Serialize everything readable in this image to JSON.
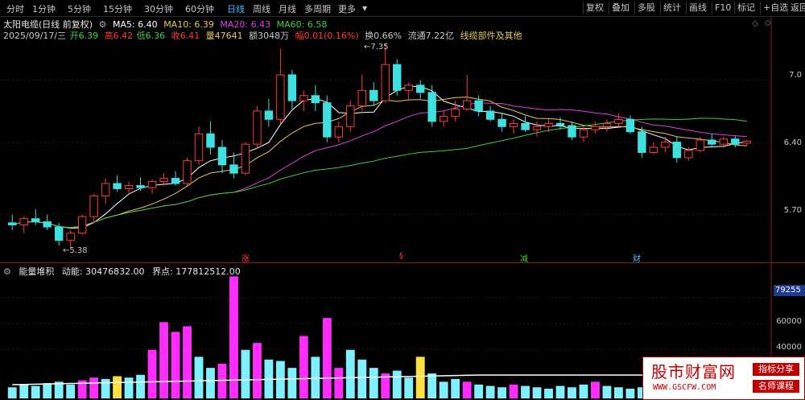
{
  "toolbar": {
    "tabs": [
      "分时",
      "1分钟",
      "5分钟",
      "15分钟",
      "30分钟",
      "60分钟",
      "日线",
      "周线",
      "月线",
      "多周期",
      "更多"
    ],
    "active_tab": "日线",
    "right_buttons": [
      "复权",
      "叠加",
      "多股",
      "统计",
      "画线",
      "F10",
      "标记",
      "+自选",
      "返回"
    ]
  },
  "header": {
    "stock_name": "太阳电缆(日线 前复权)",
    "ma5": "MA5: 6.40",
    "ma10": "MA10: 6.39",
    "ma20": "MA20: 6.43",
    "ma60": "MA60: 6.58",
    "date": "2025/09/17/三",
    "open": "开6.39",
    "high": "高6.42",
    "low": "低6.36",
    "close": "收6.41",
    "volume": "量47641",
    "amount": "额3048万",
    "change": "幅0.01(0.16%)",
    "turnover": "换0.66%",
    "float_cap": "流通7.22亿",
    "sector": "线缆部件及其他"
  },
  "price_axis": {
    "labels": [
      "7.0",
      "6.40",
      "5.70"
    ]
  },
  "annotations": {
    "high_label": "7.35",
    "low_label": "5.38"
  },
  "events": [
    "涨",
    "§",
    "减",
    "财"
  ],
  "volume_panel": {
    "indicator": "能量堆积",
    "momentum": "动能: 30476832.00",
    "boundary": "界点: 177812512.00",
    "axis_labels": [
      "79255",
      "60000",
      "40000"
    ],
    "current_tag": "79255"
  },
  "watermark": {
    "site_name": "股市财富网",
    "url": "WWW.GSCFW.COM",
    "tag1": "指标分享",
    "tag2": "名师课程"
  },
  "colors": {
    "up": "#ff3b3b",
    "down": "#3fe0e0",
    "ma5": "#ffffff",
    "ma10": "#e6c85a",
    "ma20": "#e040e0",
    "ma60": "#40d040",
    "vol_magenta": "#ff2cff",
    "vol_cyan": "#7ef0ff",
    "vol_yellow": "#ffe040"
  },
  "chart_data": {
    "type": "candlestick",
    "price_range": [
      5.3,
      7.4
    ],
    "candles": [
      {
        "o": 5.62,
        "h": 5.7,
        "l": 5.55,
        "c": 5.6
      },
      {
        "o": 5.6,
        "h": 5.68,
        "l": 5.52,
        "c": 5.66
      },
      {
        "o": 5.66,
        "h": 5.75,
        "l": 5.6,
        "c": 5.63
      },
      {
        "o": 5.63,
        "h": 5.7,
        "l": 5.55,
        "c": 5.58
      },
      {
        "o": 5.58,
        "h": 5.62,
        "l": 5.4,
        "c": 5.45
      },
      {
        "o": 5.45,
        "h": 5.55,
        "l": 5.38,
        "c": 5.52
      },
      {
        "o": 5.52,
        "h": 5.7,
        "l": 5.5,
        "c": 5.68
      },
      {
        "o": 5.68,
        "h": 5.9,
        "l": 5.62,
        "c": 5.88
      },
      {
        "o": 5.88,
        "h": 6.05,
        "l": 5.8,
        "c": 6.0
      },
      {
        "o": 6.0,
        "h": 6.08,
        "l": 5.92,
        "c": 5.95
      },
      {
        "o": 5.95,
        "h": 6.02,
        "l": 5.9,
        "c": 5.98
      },
      {
        "o": 5.98,
        "h": 6.06,
        "l": 5.93,
        "c": 5.96
      },
      {
        "o": 5.96,
        "h": 6.04,
        "l": 5.9,
        "c": 6.02
      },
      {
        "o": 6.02,
        "h": 6.1,
        "l": 5.98,
        "c": 6.05
      },
      {
        "o": 6.05,
        "h": 6.12,
        "l": 5.98,
        "c": 6.0
      },
      {
        "o": 6.0,
        "h": 6.25,
        "l": 5.98,
        "c": 6.22
      },
      {
        "o": 6.22,
        "h": 6.55,
        "l": 6.18,
        "c": 6.48
      },
      {
        "o": 6.48,
        "h": 6.6,
        "l": 6.28,
        "c": 6.35
      },
      {
        "o": 6.35,
        "h": 6.42,
        "l": 6.1,
        "c": 6.18
      },
      {
        "o": 6.18,
        "h": 6.3,
        "l": 6.05,
        "c": 6.1
      },
      {
        "o": 6.1,
        "h": 6.4,
        "l": 6.08,
        "c": 6.38
      },
      {
        "o": 6.38,
        "h": 6.75,
        "l": 6.35,
        "c": 6.7
      },
      {
        "o": 6.7,
        "h": 6.82,
        "l": 6.55,
        "c": 6.62
      },
      {
        "o": 6.62,
        "h": 7.3,
        "l": 6.58,
        "c": 7.05
      },
      {
        "o": 7.05,
        "h": 7.1,
        "l": 6.72,
        "c": 6.8
      },
      {
        "o": 6.8,
        "h": 6.9,
        "l": 6.7,
        "c": 6.85
      },
      {
        "o": 6.85,
        "h": 6.95,
        "l": 6.7,
        "c": 6.78
      },
      {
        "o": 6.78,
        "h": 6.85,
        "l": 6.4,
        "c": 6.45
      },
      {
        "o": 6.45,
        "h": 6.6,
        "l": 6.4,
        "c": 6.55
      },
      {
        "o": 6.55,
        "h": 6.8,
        "l": 6.5,
        "c": 6.75
      },
      {
        "o": 6.75,
        "h": 7.05,
        "l": 6.7,
        "c": 6.9
      },
      {
        "o": 6.9,
        "h": 6.98,
        "l": 6.75,
        "c": 6.8
      },
      {
        "o": 6.8,
        "h": 7.35,
        "l": 6.78,
        "c": 7.15
      },
      {
        "o": 7.15,
        "h": 7.2,
        "l": 6.85,
        "c": 6.9
      },
      {
        "o": 6.9,
        "h": 6.98,
        "l": 6.8,
        "c": 6.95
      },
      {
        "o": 6.95,
        "h": 7.0,
        "l": 6.82,
        "c": 6.88
      },
      {
        "o": 6.88,
        "h": 6.95,
        "l": 6.55,
        "c": 6.6
      },
      {
        "o": 6.6,
        "h": 6.7,
        "l": 6.55,
        "c": 6.65
      },
      {
        "o": 6.65,
        "h": 6.8,
        "l": 6.6,
        "c": 6.72
      },
      {
        "o": 6.72,
        "h": 7.05,
        "l": 6.7,
        "c": 6.8
      },
      {
        "o": 6.8,
        "h": 6.85,
        "l": 6.65,
        "c": 6.7
      },
      {
        "o": 6.7,
        "h": 6.75,
        "l": 6.6,
        "c": 6.62
      },
      {
        "o": 6.62,
        "h": 6.68,
        "l": 6.5,
        "c": 6.55
      },
      {
        "o": 6.55,
        "h": 6.62,
        "l": 6.48,
        "c": 6.58
      },
      {
        "o": 6.58,
        "h": 6.65,
        "l": 6.5,
        "c": 6.52
      },
      {
        "o": 6.52,
        "h": 6.6,
        "l": 6.45,
        "c": 6.55
      },
      {
        "o": 6.55,
        "h": 6.62,
        "l": 6.5,
        "c": 6.58
      },
      {
        "o": 6.58,
        "h": 6.64,
        "l": 6.52,
        "c": 6.56
      },
      {
        "o": 6.56,
        "h": 6.6,
        "l": 6.42,
        "c": 6.45
      },
      {
        "o": 6.45,
        "h": 6.55,
        "l": 6.4,
        "c": 6.52
      },
      {
        "o": 6.52,
        "h": 6.6,
        "l": 6.48,
        "c": 6.55
      },
      {
        "o": 6.55,
        "h": 6.62,
        "l": 6.5,
        "c": 6.58
      },
      {
        "o": 6.58,
        "h": 6.68,
        "l": 6.55,
        "c": 6.62
      },
      {
        "o": 6.62,
        "h": 6.66,
        "l": 6.48,
        "c": 6.5
      },
      {
        "o": 6.5,
        "h": 6.55,
        "l": 6.25,
        "c": 6.3
      },
      {
        "o": 6.3,
        "h": 6.4,
        "l": 6.28,
        "c": 6.35
      },
      {
        "o": 6.35,
        "h": 6.45,
        "l": 6.3,
        "c": 6.4
      },
      {
        "o": 6.4,
        "h": 6.45,
        "l": 6.2,
        "c": 6.25
      },
      {
        "o": 6.25,
        "h": 6.35,
        "l": 6.22,
        "c": 6.32
      },
      {
        "o": 6.32,
        "h": 6.45,
        "l": 6.3,
        "c": 6.42
      },
      {
        "o": 6.42,
        "h": 6.48,
        "l": 6.36,
        "c": 6.38
      },
      {
        "o": 6.38,
        "h": 6.45,
        "l": 6.34,
        "c": 6.43
      },
      {
        "o": 6.43,
        "h": 6.46,
        "l": 6.35,
        "c": 6.38
      },
      {
        "o": 6.39,
        "h": 6.42,
        "l": 6.36,
        "c": 6.41
      }
    ],
    "volume": [
      {
        "v": 8,
        "c": "cyan"
      },
      {
        "v": 10,
        "c": "cyan"
      },
      {
        "v": 9,
        "c": "cyan"
      },
      {
        "v": 11,
        "c": "cyan"
      },
      {
        "v": 12,
        "c": "cyan"
      },
      {
        "v": 10,
        "c": "cyan"
      },
      {
        "v": 13,
        "c": "magenta"
      },
      {
        "v": 15,
        "c": "magenta"
      },
      {
        "v": 14,
        "c": "cyan"
      },
      {
        "v": 16,
        "c": "yellow"
      },
      {
        "v": 15,
        "c": "cyan"
      },
      {
        "v": 17,
        "c": "cyan"
      },
      {
        "v": 35,
        "c": "magenta"
      },
      {
        "v": 55,
        "c": "magenta"
      },
      {
        "v": 48,
        "c": "magenta"
      },
      {
        "v": 52,
        "c": "magenta"
      },
      {
        "v": 30,
        "c": "cyan"
      },
      {
        "v": 22,
        "c": "cyan"
      },
      {
        "v": 25,
        "c": "magenta"
      },
      {
        "v": 88,
        "c": "magenta"
      },
      {
        "v": 35,
        "c": "cyan"
      },
      {
        "v": 40,
        "c": "magenta"
      },
      {
        "v": 28,
        "c": "cyan"
      },
      {
        "v": 27,
        "c": "cyan"
      },
      {
        "v": 22,
        "c": "cyan"
      },
      {
        "v": 45,
        "c": "magenta"
      },
      {
        "v": 30,
        "c": "cyan"
      },
      {
        "v": 58,
        "c": "magenta"
      },
      {
        "v": 22,
        "c": "magenta"
      },
      {
        "v": 35,
        "c": "cyan"
      },
      {
        "v": 28,
        "c": "cyan"
      },
      {
        "v": 22,
        "c": "cyan"
      },
      {
        "v": 18,
        "c": "magenta"
      },
      {
        "v": 20,
        "c": "cyan"
      },
      {
        "v": 15,
        "c": "cyan"
      },
      {
        "v": 30,
        "c": "yellow"
      },
      {
        "v": 18,
        "c": "cyan"
      },
      {
        "v": 12,
        "c": "cyan"
      },
      {
        "v": 14,
        "c": "cyan"
      },
      {
        "v": 12,
        "c": "magenta"
      },
      {
        "v": 10,
        "c": "cyan"
      },
      {
        "v": 9,
        "c": "cyan"
      },
      {
        "v": 8,
        "c": "cyan"
      },
      {
        "v": 10,
        "c": "magenta"
      },
      {
        "v": 9,
        "c": "cyan"
      },
      {
        "v": 8,
        "c": "cyan"
      },
      {
        "v": 7,
        "c": "cyan"
      },
      {
        "v": 9,
        "c": "cyan"
      },
      {
        "v": 8,
        "c": "cyan"
      },
      {
        "v": 10,
        "c": "cyan"
      },
      {
        "v": 12,
        "c": "magenta"
      },
      {
        "v": 9,
        "c": "cyan"
      },
      {
        "v": 8,
        "c": "cyan"
      },
      {
        "v": 7,
        "c": "cyan"
      },
      {
        "v": 8,
        "c": "cyan"
      },
      {
        "v": 9,
        "c": "cyan"
      },
      {
        "v": 7,
        "c": "cyan"
      },
      {
        "v": 8,
        "c": "cyan"
      },
      {
        "v": 7,
        "c": "cyan"
      },
      {
        "v": 9,
        "c": "cyan"
      },
      {
        "v": 8,
        "c": "cyan"
      },
      {
        "v": 7,
        "c": "cyan"
      },
      {
        "v": 8,
        "c": "cyan"
      }
    ]
  }
}
